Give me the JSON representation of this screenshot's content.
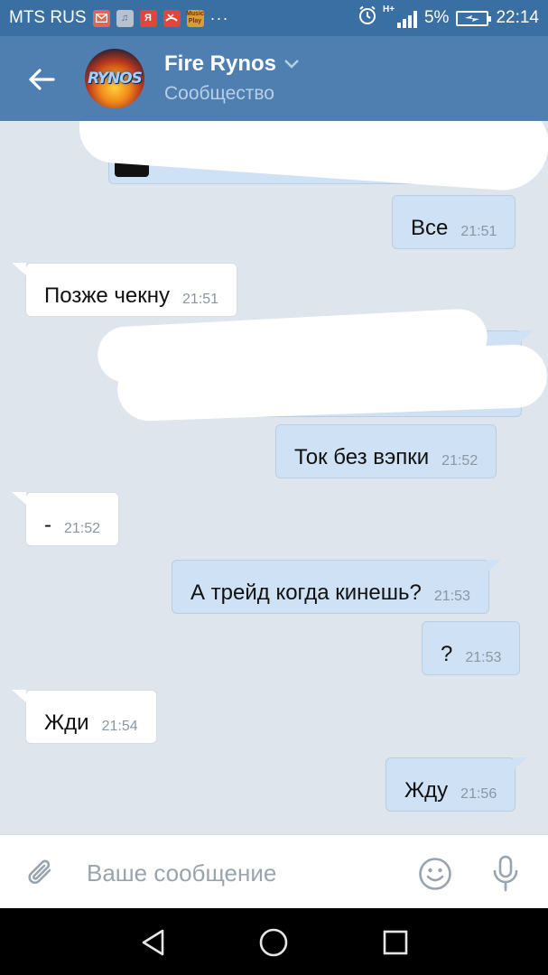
{
  "status_bar": {
    "carrier": "MTS RUS",
    "notif_music": "♫",
    "notif_ya": "Я",
    "notif_play_line1": "Music",
    "notif_play_line2": "Play",
    "more": "···",
    "network": "H+",
    "battery_percent": "5%",
    "time": "22:14"
  },
  "header": {
    "title": "Fire Rynos",
    "subtitle": "Сообщество",
    "avatar_text": "RYNOS"
  },
  "messages": [
    {
      "direction": "out",
      "text": "",
      "time": ""
    },
    {
      "direction": "out",
      "text": "Все",
      "time": "21:51"
    },
    {
      "direction": "in",
      "text": "Позже чекну",
      "time": "21:51"
    },
    {
      "direction": "out",
      "text": "",
      "time": ""
    },
    {
      "direction": "out",
      "text": "Ток без вэпки",
      "time": "21:52"
    },
    {
      "direction": "in",
      "text": "-",
      "time": "21:52"
    },
    {
      "direction": "out",
      "text": "А трейд когда кинешь?",
      "time": "21:53"
    },
    {
      "direction": "out",
      "text": "?",
      "time": "21:53"
    },
    {
      "direction": "in",
      "text": "Жди",
      "time": "21:54"
    },
    {
      "direction": "out",
      "text": "Жду",
      "time": "21:56"
    }
  ],
  "input": {
    "placeholder": "Ваше сообщение",
    "value": ""
  },
  "colors": {
    "status_bar": "#3a6fa3",
    "header": "#4f7fb0",
    "chat_bg": "#dfe5ec",
    "outgoing_bubble": "#cfe1f4",
    "incoming_bubble": "#ffffff",
    "icon_gray": "#9aa4ae"
  },
  "icons": {
    "back": "arrow-left-icon",
    "attach": "paperclip-icon",
    "emoji": "smiley-icon",
    "mic": "microphone-icon",
    "nav_back": "triangle-back-icon",
    "nav_home": "circle-home-icon",
    "nav_recents": "square-recents-icon"
  }
}
